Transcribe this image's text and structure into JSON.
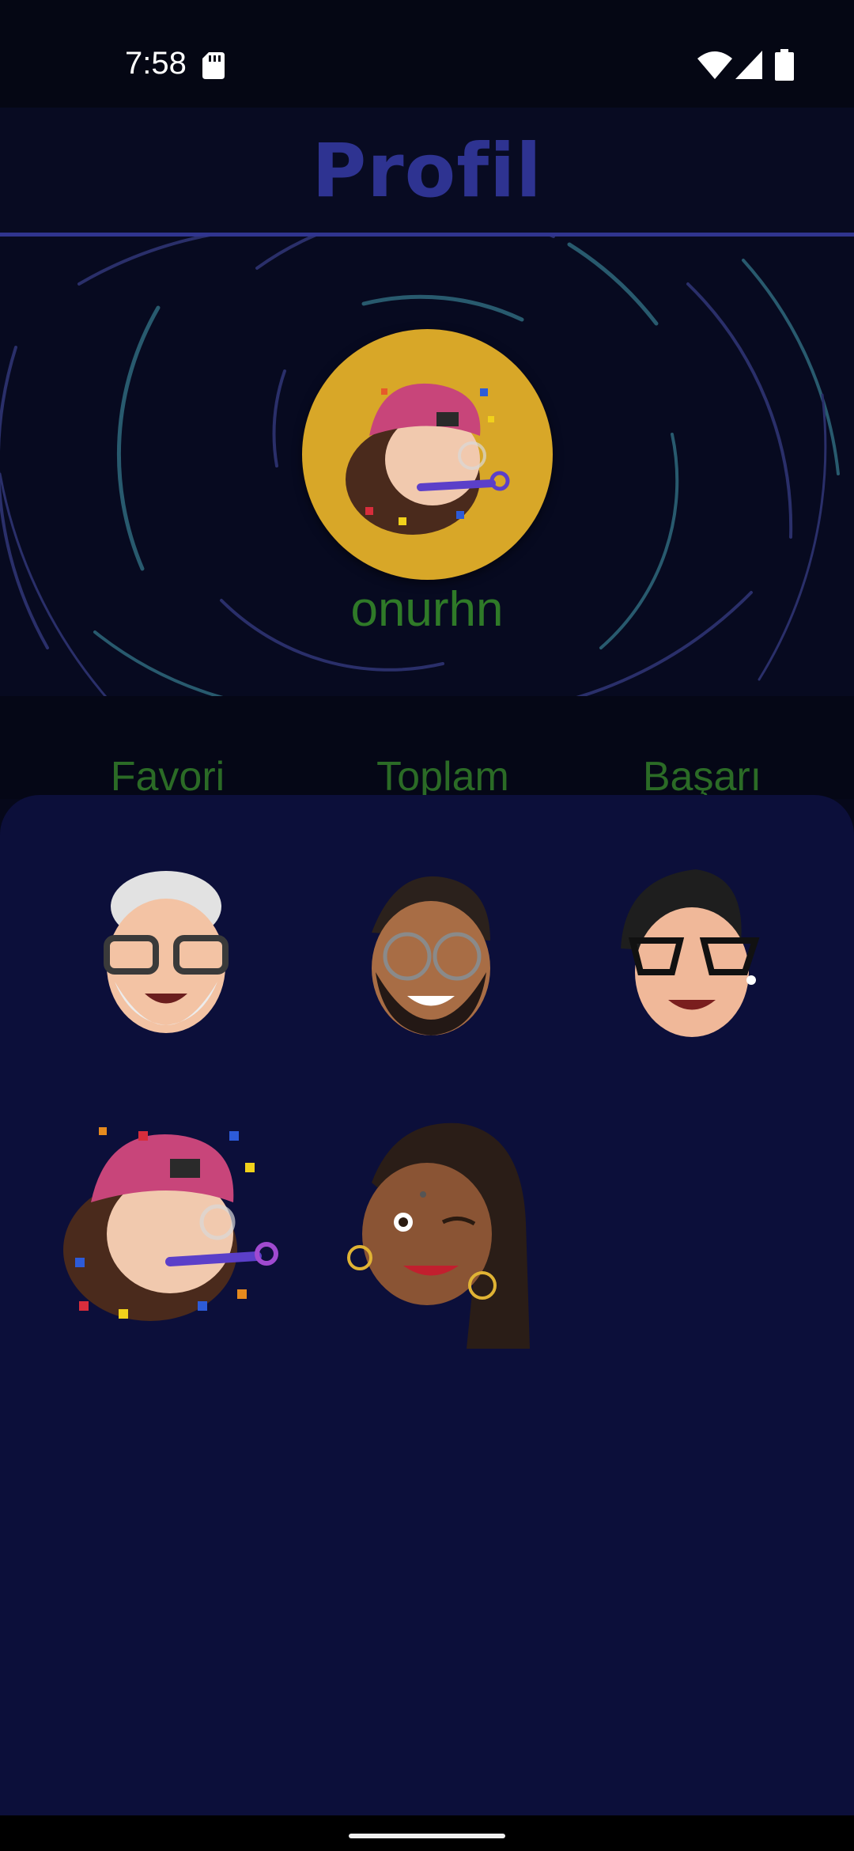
{
  "status_bar": {
    "time": "7:58"
  },
  "header": {
    "title": "Profil"
  },
  "profile": {
    "username": "onurhn"
  },
  "stats": {
    "favorite": "Favori",
    "total": "Toplam",
    "success": "Başarı"
  },
  "colors": {
    "title": "#2e3391",
    "avatar_bg": "#d8a728",
    "green_text": "#2f7a28",
    "sheet_bg": "#0c0f3a"
  },
  "memojis": [
    {
      "name": "memoji-grey-hair-glasses"
    },
    {
      "name": "memoji-beard-glasses"
    },
    {
      "name": "memoji-cat-eye-glasses"
    },
    {
      "name": "memoji-party-pink-cap"
    },
    {
      "name": "memoji-braids-wink"
    }
  ]
}
